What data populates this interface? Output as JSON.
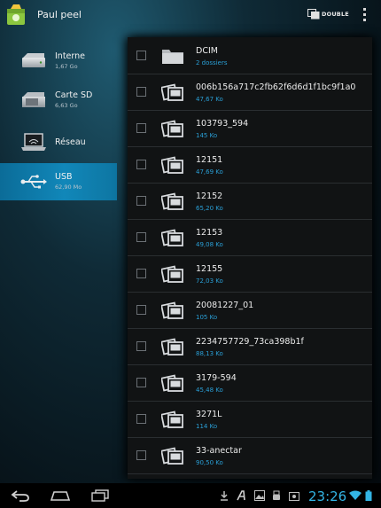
{
  "app": {
    "title": "Paul peel",
    "dual_label": "DOUBLE"
  },
  "sidebar": {
    "items": [
      {
        "label": "Interne",
        "sub": "1,67 Go",
        "icon": "hard-drive-icon",
        "active": false
      },
      {
        "label": "Carte SD",
        "sub": "6,63 Go",
        "icon": "sd-card-icon",
        "active": false
      },
      {
        "label": "Réseau",
        "sub": "",
        "icon": "network-laptop-icon",
        "active": false
      },
      {
        "label": "USB",
        "sub": "62,90 Mo",
        "icon": "usb-icon",
        "active": true
      }
    ]
  },
  "files": [
    {
      "name": "DCIM",
      "sub": "2 dossiers",
      "type": "folder"
    },
    {
      "name": "006b156a717c2fb62f6d6d1f1bc9f1a0",
      "sub": "47,67 Ko",
      "type": "image"
    },
    {
      "name": "103793_594",
      "sub": "145 Ko",
      "type": "image"
    },
    {
      "name": "12151",
      "sub": "47,69 Ko",
      "type": "image"
    },
    {
      "name": "12152",
      "sub": "65,20 Ko",
      "type": "image"
    },
    {
      "name": "12153",
      "sub": "49,08 Ko",
      "type": "image"
    },
    {
      "name": "12155",
      "sub": "72,03 Ko",
      "type": "image"
    },
    {
      "name": "20081227_01",
      "sub": "105 Ko",
      "type": "image"
    },
    {
      "name": "2234757729_73ca398b1f",
      "sub": "88,13 Ko",
      "type": "image"
    },
    {
      "name": "3179-594",
      "sub": "45,48 Ko",
      "type": "image"
    },
    {
      "name": "3271L",
      "sub": "114 Ko",
      "type": "image"
    },
    {
      "name": "33-anectar",
      "sub": "90,50 Ko",
      "type": "image"
    }
  ],
  "status": {
    "time": "23:26",
    "icons": [
      "download-icon",
      "font-icon",
      "image-icon",
      "usb-debug-icon",
      "screenshot-icon",
      "wifi-icon",
      "battery-icon"
    ]
  },
  "colors": {
    "accent": "#33b5e5",
    "selected_bg": "#1187b9",
    "size_text": "#2a9fd6"
  }
}
